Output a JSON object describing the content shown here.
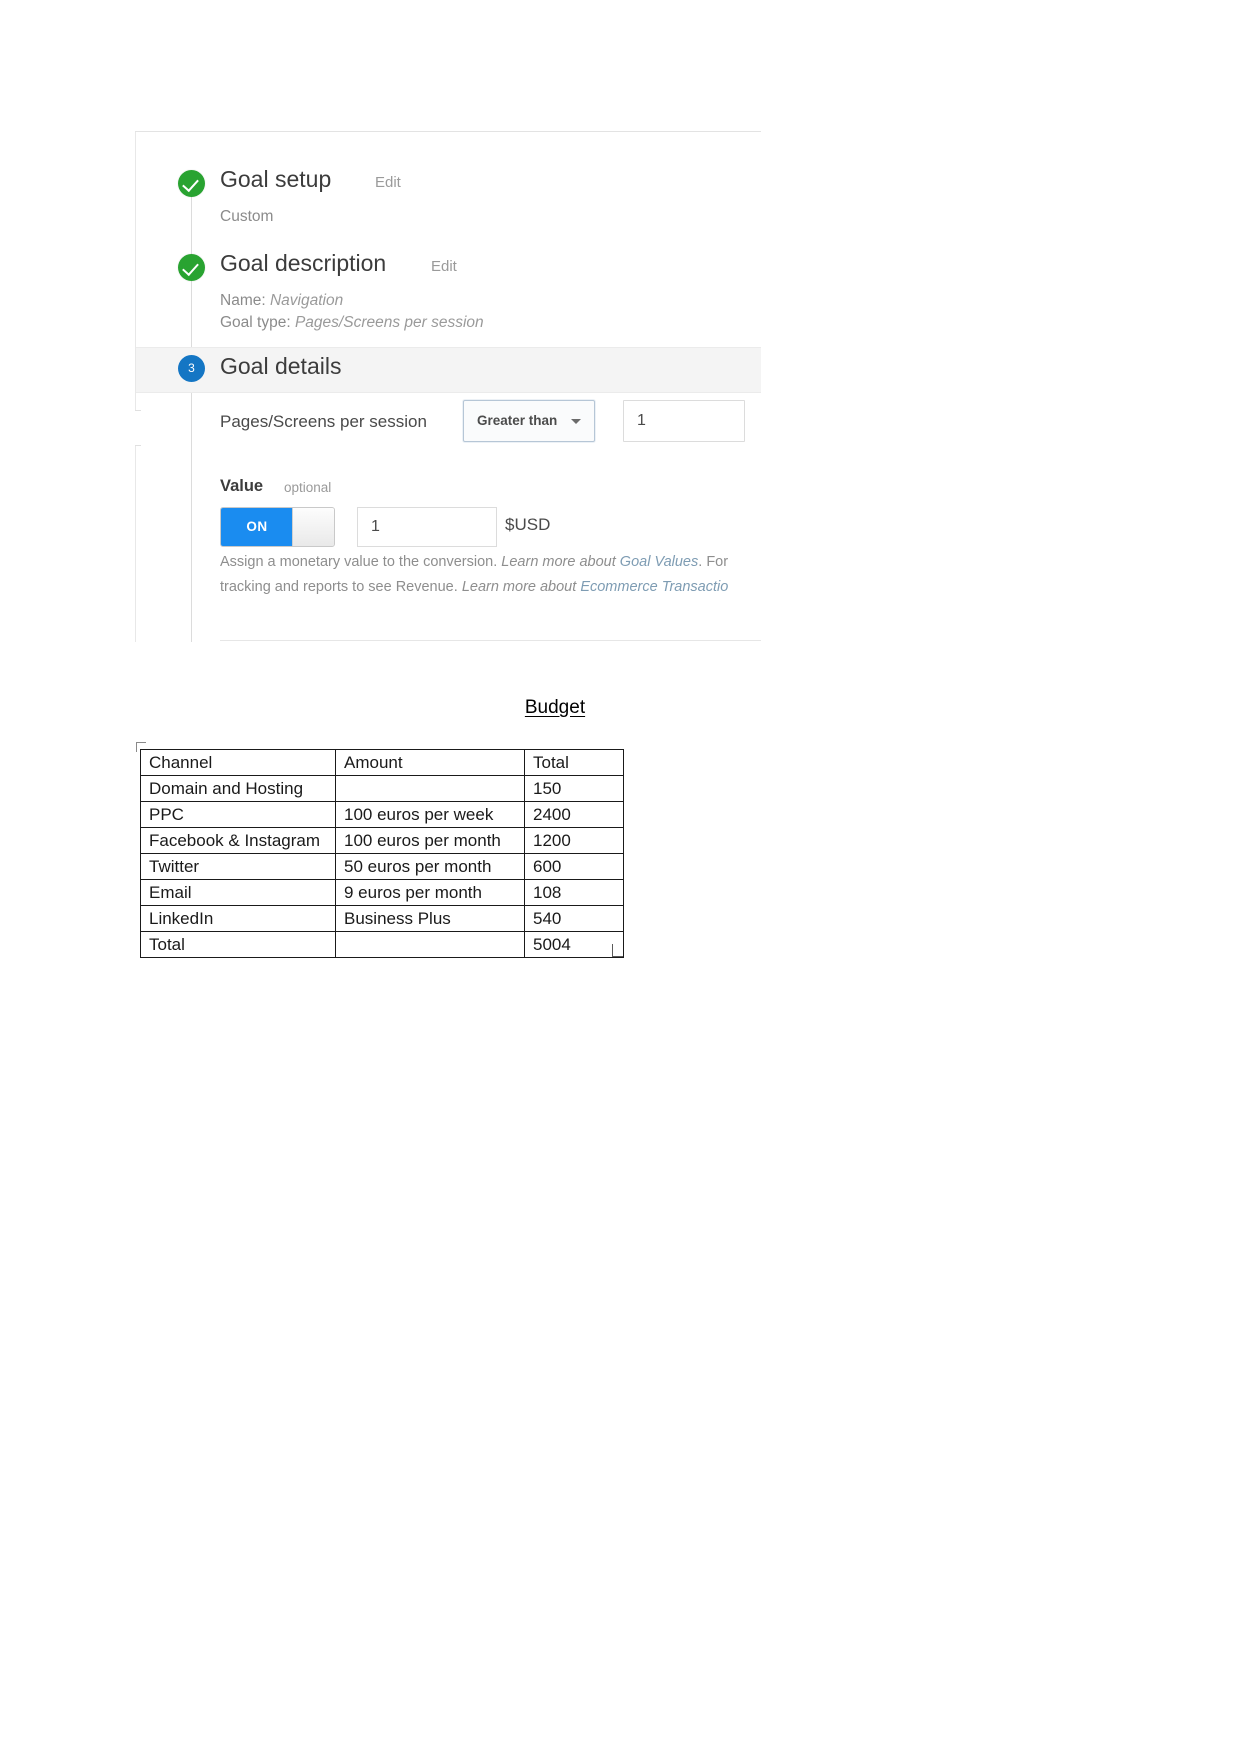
{
  "analytics_panel": {
    "steps": [
      {
        "status_icon": "check-circle-icon",
        "title": "Goal setup",
        "edit_label": "Edit",
        "detail_lines": [
          "Custom"
        ]
      },
      {
        "status_icon": "check-circle-icon",
        "title": "Goal description",
        "edit_label": "Edit",
        "name_label": "Name:",
        "name_value": "Navigation",
        "type_label": "Goal type:",
        "type_value": "Pages/Screens per session"
      },
      {
        "status_icon": "number-badge-3",
        "badge_number": "3",
        "title": "Goal details"
      }
    ],
    "goal_details": {
      "condition_label": "Pages/Screens per session",
      "operator_value": "Greater than",
      "threshold_value": "1"
    },
    "value_section": {
      "heading": "Value",
      "optional_label": "optional",
      "toggle_state": "ON",
      "amount_value": "1",
      "currency_label": "$USD",
      "help_line_1_prefix": "Assign a monetary value to the conversion.",
      "help_line_1_link_prefix": "Learn more about",
      "help_line_1_link": "Goal Values",
      "help_line_1_suffix": ". For",
      "help_line_2_prefix": "tracking and reports to see Revenue.",
      "help_line_2_link_prefix": "Learn more about",
      "help_line_2_link": "Ecommerce Transactio"
    },
    "colors": {
      "check_green": "#29a331",
      "step_blue": "#1476c4",
      "toggle_blue": "#1a8cf0",
      "link_gray_blue": "#7e9cb3"
    }
  },
  "budget": {
    "heading": "Budget",
    "columns": [
      "Channel",
      "Amount",
      "Total"
    ],
    "rows": [
      {
        "channel": "Domain and Hosting",
        "amount": "",
        "total": "150"
      },
      {
        "channel": "PPC",
        "amount": "100 euros per week",
        "total": "2400"
      },
      {
        "channel": "Facebook & Instagram",
        "amount": "100 euros per month",
        "total": "1200"
      },
      {
        "channel": "Twitter",
        "amount": "50 euros per month",
        "total": "600"
      },
      {
        "channel": "Email",
        "amount": "9 euros per month",
        "total": "108"
      },
      {
        "channel": "LinkedIn",
        "amount": "Business Plus",
        "total": "540"
      },
      {
        "channel": "Total",
        "amount": "",
        "total": "5004"
      }
    ]
  }
}
